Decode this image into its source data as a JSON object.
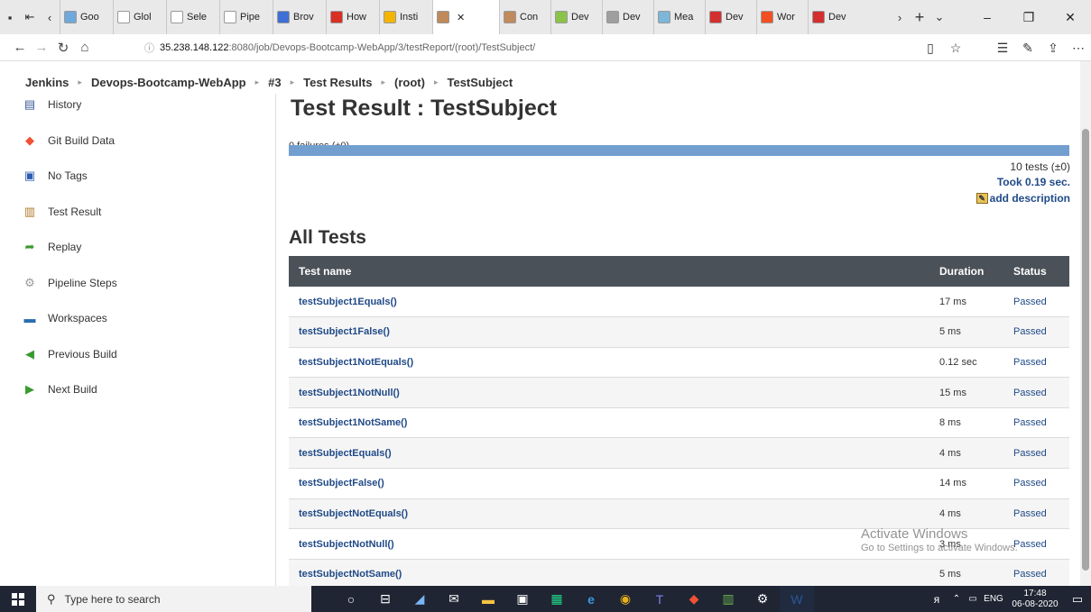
{
  "browser": {
    "tabs": [
      {
        "label": "Goo",
        "icon": "gear-icon",
        "color": "#6fa8dc"
      },
      {
        "label": "Glol",
        "icon": "page-icon",
        "color": "#ffffff"
      },
      {
        "label": "Sele",
        "icon": "page-icon",
        "color": "#ffffff"
      },
      {
        "label": "Pipe",
        "icon": "page-icon",
        "color": "#ffffff"
      },
      {
        "label": "Brov",
        "icon": "browserstack-icon",
        "color": "#3d6fd6"
      },
      {
        "label": "How",
        "icon": "opera-icon",
        "color": "#d93025"
      },
      {
        "label": "Insti",
        "icon": "chat-icon",
        "color": "#f4b400"
      },
      {
        "label": "",
        "icon": "jenkins-icon",
        "color": "#c08a5b",
        "active": true
      },
      {
        "label": "Con",
        "icon": "jenkins-icon",
        "color": "#c08a5b"
      },
      {
        "label": "Dev",
        "icon": "leaf-icon",
        "color": "#8bc34a"
      },
      {
        "label": "Dev",
        "icon": "image-icon",
        "color": "#9e9e9e"
      },
      {
        "label": "Mea",
        "icon": "medium-icon",
        "color": "#7eb6d9"
      },
      {
        "label": "Dev",
        "icon": "pdf-icon",
        "color": "#d32f2f"
      },
      {
        "label": "Wor",
        "icon": "windows-icon",
        "color": "#f25022"
      },
      {
        "label": "Dev",
        "icon": "pdf-icon",
        "color": "#d32f2f"
      }
    ],
    "url_prefix": "35.238.148.122",
    "url_rest": ":8080/job/Devops-Bootcamp-WebApp/3/testReport/(root)/TestSubject/"
  },
  "breadcrumb": [
    {
      "label": "Jenkins"
    },
    {
      "label": "Devops-Bootcamp-WebApp"
    },
    {
      "label": "#3"
    },
    {
      "label": "Test Results"
    },
    {
      "label": "(root)"
    },
    {
      "label": "TestSubject"
    }
  ],
  "sidebar": {
    "items": [
      {
        "label": "History",
        "icon": "history-icon"
      },
      {
        "label": "Git Build Data",
        "icon": "git-icon"
      },
      {
        "label": "No Tags",
        "icon": "save-icon"
      },
      {
        "label": "Test Result",
        "icon": "clipboard-icon"
      },
      {
        "label": "Replay",
        "icon": "replay-icon"
      },
      {
        "label": "Pipeline Steps",
        "icon": "gear-icon"
      },
      {
        "label": "Workspaces",
        "icon": "folder-icon"
      },
      {
        "label": "Previous Build",
        "icon": "arrow-left-icon"
      },
      {
        "label": "Next Build",
        "icon": "arrow-right-icon"
      }
    ]
  },
  "main": {
    "title": "Test Result : TestSubject",
    "failures": "0 failures (±0)",
    "tests_count": "10 tests (±0)",
    "took": "Took 0.19 sec.",
    "add_description": "add description",
    "section_title": "All Tests",
    "columns": {
      "name": "Test name",
      "duration": "Duration",
      "status": "Status"
    },
    "rows": [
      {
        "name": "testSubject1Equals()",
        "duration": "17 ms",
        "status": "Passed"
      },
      {
        "name": "testSubject1False()",
        "duration": "5 ms",
        "status": "Passed"
      },
      {
        "name": "testSubject1NotEquals()",
        "duration": "0.12 sec",
        "status": "Passed"
      },
      {
        "name": "testSubject1NotNull()",
        "duration": "15 ms",
        "status": "Passed"
      },
      {
        "name": "testSubject1NotSame()",
        "duration": "8 ms",
        "status": "Passed"
      },
      {
        "name": "testSubjectEquals()",
        "duration": "4 ms",
        "status": "Passed"
      },
      {
        "name": "testSubjectFalse()",
        "duration": "14 ms",
        "status": "Passed"
      },
      {
        "name": "testSubjectNotEquals()",
        "duration": "4 ms",
        "status": "Passed"
      },
      {
        "name": "testSubjectNotNull()",
        "duration": "3 ms",
        "status": "Passed"
      },
      {
        "name": "testSubjectNotSame()",
        "duration": "5 ms",
        "status": "Passed"
      }
    ]
  },
  "watermark": {
    "line1": "Activate Windows",
    "line2": "Go to Settings to activate Windows."
  },
  "taskbar": {
    "search_placeholder": "Type here to search",
    "lang": "ENG",
    "time": "17:48",
    "date": "06-08-2020"
  },
  "colors": {
    "link": "#204a87",
    "header_bg": "#4b5158",
    "progress": "#729fcf"
  }
}
